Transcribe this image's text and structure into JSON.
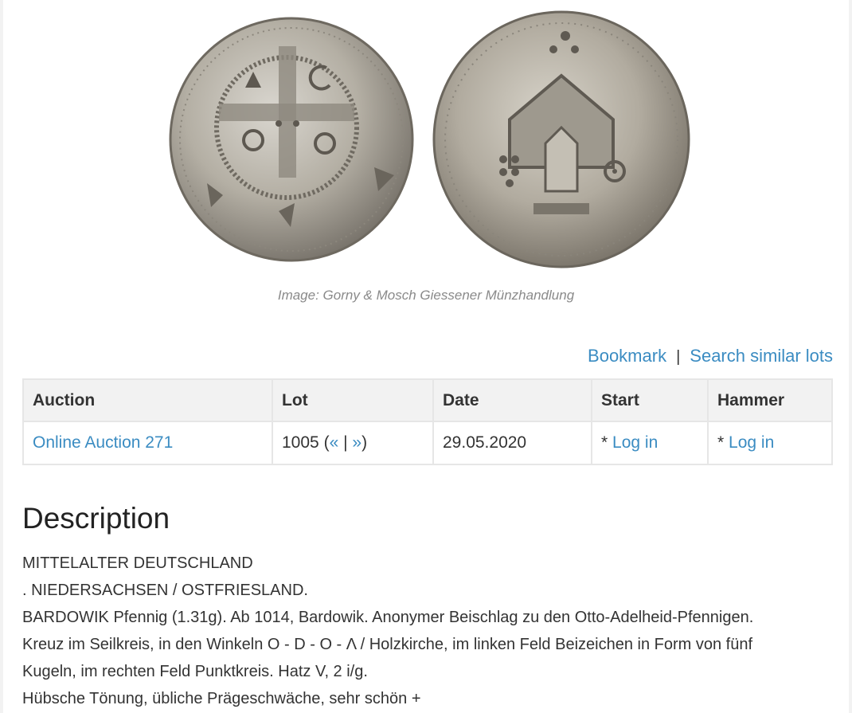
{
  "image": {
    "alt": "Obverse and reverse of silver pfennig",
    "caption": "Image: Gorny & Mosch Giessener Münzhandlung"
  },
  "actions": {
    "bookmark": "Bookmark",
    "separator": "|",
    "search_similar": "Search similar lots"
  },
  "table": {
    "headers": [
      "Auction",
      "Lot",
      "Date",
      "Start",
      "Hammer"
    ],
    "row": {
      "auction": "Online Auction 271",
      "lot_number": "1005",
      "lot_open": "(",
      "prev": "«",
      "pipe": "|",
      "next": "»",
      "lot_close": ")",
      "date": "29.05.2020",
      "start_prefix": "*",
      "start_login": "Log in",
      "hammer_prefix": "*",
      "hammer_login": "Log in"
    }
  },
  "description": {
    "title": "Description",
    "lines": [
      "MITTELALTER DEUTSCHLAND",
      ". NIEDERSACHSEN / OSTFRIESLAND.",
      "BARDOWIK Pfennig (1.31g). Ab 1014, Bardowik. Anonymer Beischlag zu den Otto-Adelheid-Pfennigen.",
      "Kreuz im Seilkreis, in den Winkeln O - D - O - Λ / Holzkirche, im linken Feld Beizeichen in Form von fünf",
      "Kugeln, im rechten Feld Punktkreis. Hatz V, 2 i/g.",
      "Hübsche Tönung, übliche Prägeschwäche, sehr schön +"
    ]
  },
  "colors": {
    "link": "#3b8cc2",
    "header_bg": "#f2f2f2",
    "border": "#e6e6e6"
  }
}
